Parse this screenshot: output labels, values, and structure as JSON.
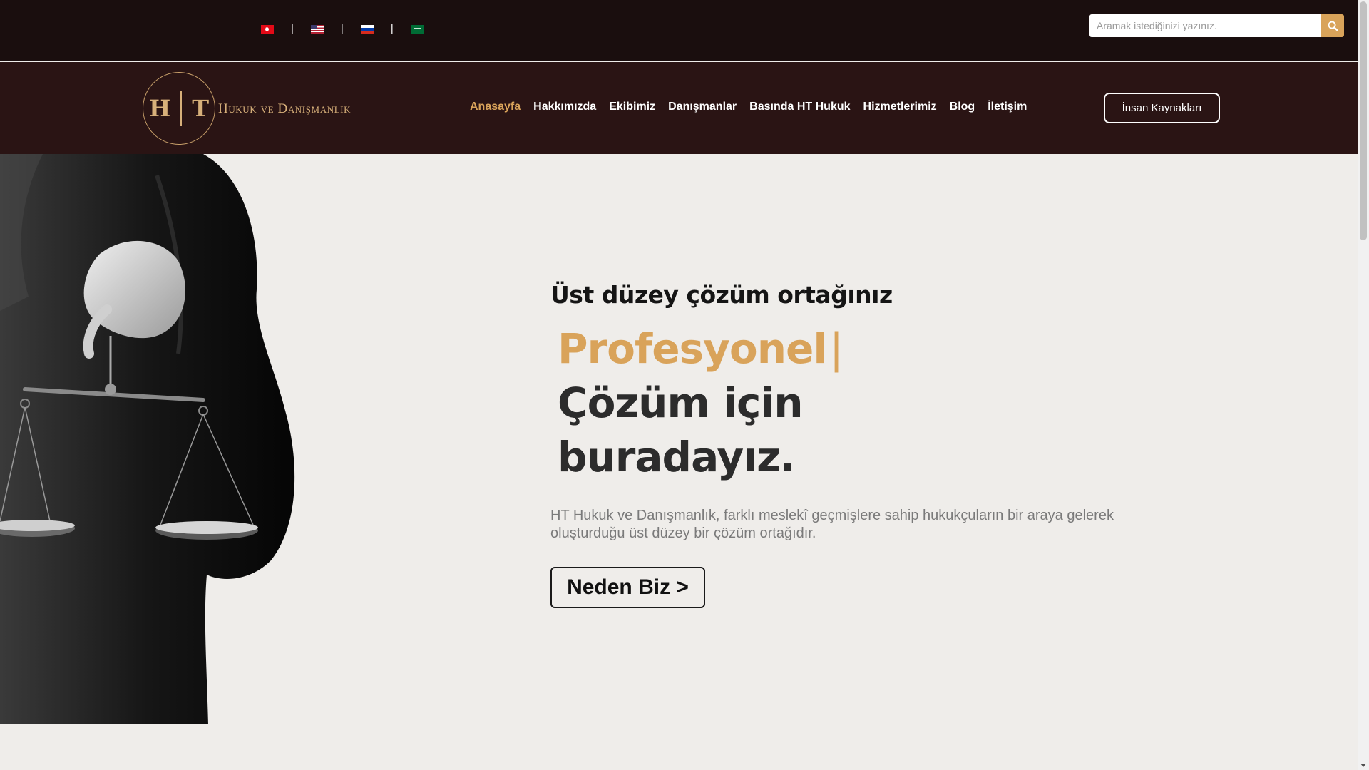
{
  "topbar": {
    "languages": [
      {
        "code": "tr",
        "icon": "flag-tr-icon"
      },
      {
        "code": "en",
        "icon": "flag-us-icon"
      },
      {
        "code": "ru",
        "icon": "flag-ru-icon"
      },
      {
        "code": "ar",
        "icon": "flag-sa-icon"
      }
    ],
    "separator": "|",
    "search": {
      "placeholder": "Aramak istediğinizi yazınız.",
      "icon": "search-icon"
    }
  },
  "navbar": {
    "logo": {
      "monogram_left": "H",
      "monogram_right": "T",
      "text": "Hukuk ve Danışmanlık"
    },
    "menu": [
      {
        "label": "Anasayfa",
        "active": true
      },
      {
        "label": "Hakkımızda"
      },
      {
        "label": "Ekibimiz"
      },
      {
        "label": "Danışmanlar"
      },
      {
        "label": "Basında HT Hukuk"
      },
      {
        "label": "Hizmetlerimiz"
      },
      {
        "label": "Blog"
      },
      {
        "label": "İletişim"
      }
    ],
    "hr_button": "İnsan Kaynakları"
  },
  "hero": {
    "eyebrow": "Üst düzey çözüm ortağınız",
    "headline_accent": "Profesyonel",
    "cursor": "|",
    "headline_line2": "Çözüm için",
    "headline_line3": "buradayız.",
    "lead": "HT Hukuk ve Danışmanlık, farklı meslekî geçmişlere sahip hukukçuların bir araya gelerek oluşturduğu üst düzey bir çözüm ortağıdır.",
    "cta": "Neden Biz >"
  },
  "colors": {
    "topbar_bg": "#1a0e0e",
    "navbar_bg": "#2a1414",
    "accent": "#d9a35a",
    "hero_bg": "#efedea"
  }
}
